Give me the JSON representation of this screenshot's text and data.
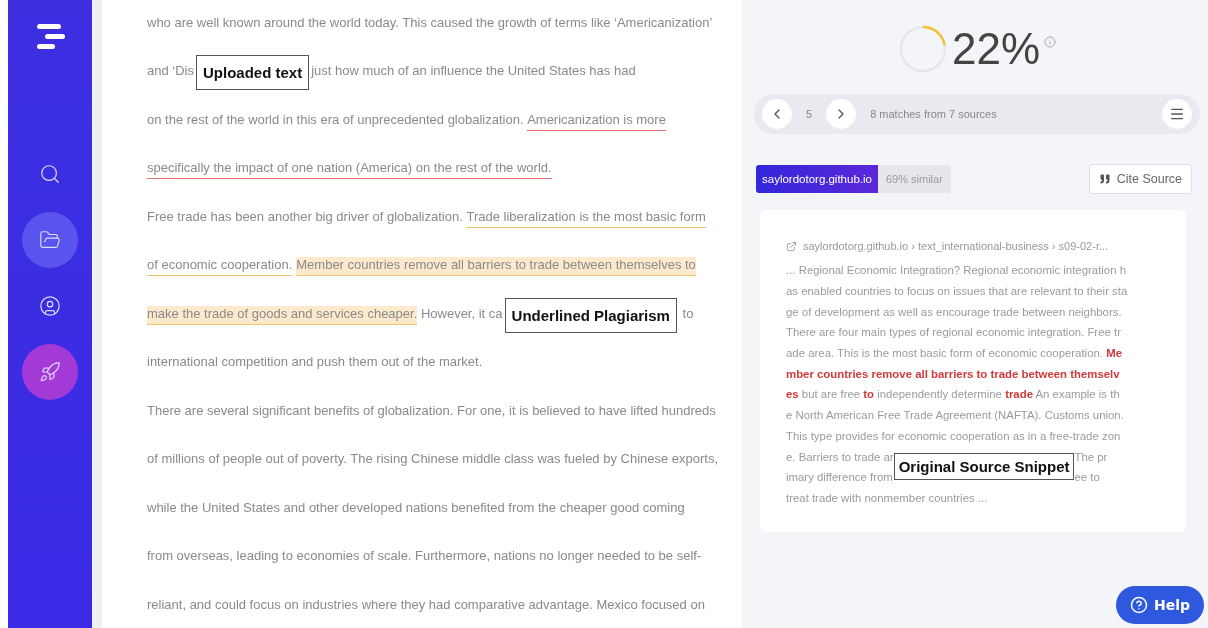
{
  "sidebar": {
    "items": [
      {
        "kind": "nav",
        "selected": false
      },
      {
        "kind": "nav",
        "selected": true
      },
      {
        "kind": "nav",
        "selected": false
      },
      {
        "kind": "accent",
        "selected": false
      }
    ]
  },
  "document": {
    "lines": [
      [
        {
          "text": "who are well known around the world today. This caused the growth of terms like ‘Americanization’",
          "kind": "plain"
        }
      ],
      [
        {
          "text": "and ‘Dis",
          "kind": "plain"
        },
        {
          "kind": "callout",
          "text": "Uploaded text"
        },
        {
          "text": "just how much of an influence the United States has had",
          "kind": "plain"
        }
      ],
      [
        {
          "text": "on the rest of the world in this era of unprecedented globalization. ",
          "kind": "plain"
        },
        {
          "text": "Americanization is more",
          "kind": "match"
        }
      ],
      [
        {
          "text": "specifically the impact of one nation (America) on the rest of the world.",
          "kind": "match"
        }
      ],
      [
        {
          "text": "Free trade has been another big driver of globalization. ",
          "kind": "plain"
        },
        {
          "text": "Trade liberalization is the most basic form",
          "kind": "partial"
        }
      ],
      [
        {
          "text": "of economic cooperation.",
          "kind": "partial"
        },
        {
          "text": "Member countries remove all barriers to trade between themselves to",
          "kind": "highlight"
        }
      ],
      [
        {
          "text": "make the trade of goods and services cheaper.",
          "kind": "highlight"
        },
        {
          "text": " However, it ca",
          "kind": "plain"
        },
        {
          "kind": "callout",
          "text": "Underlined Plagiarism"
        },
        {
          "text": " to",
          "kind": "plain"
        }
      ],
      [
        {
          "text": "international competition and push them out of the market.",
          "kind": "plain"
        }
      ],
      [
        {
          "text": "There are several significant benefits of globalization. For one, it is believed to have lifted hundreds",
          "kind": "plain"
        }
      ],
      [
        {
          "text": "of millions of people out of poverty. The rising Chinese middle class was fueled by Chinese exports,",
          "kind": "plain"
        }
      ],
      [
        {
          "text": "while the United States and other developed nations benefited from the cheaper good coming",
          "kind": "plain"
        }
      ],
      [
        {
          "text": "from overseas, leading to economies of scale. Furthermore, nations no longer needed to be self-",
          "kind": "plain"
        }
      ],
      [
        {
          "text": "reliant, and could focus on industries where they had comparative advantage. Mexico focused on",
          "kind": "plain"
        }
      ]
    ]
  },
  "score": {
    "value": "22%",
    "level": 0.22
  },
  "navigator": {
    "current": "5",
    "summary": "8 matches from 7 sources"
  },
  "source": {
    "name": "saylordotorg.github.io",
    "similarity": "69% similar",
    "cite_button": "Cite Source",
    "breadcrumb": "saylordotorg.github.io › text_international-business › s09-02-r...",
    "lines_before": [
      [
        {
          "text": "... Regional Economic Integration? Regional economic integration h",
          "match": false
        }
      ],
      [
        {
          "text": "as enabled countries to focus on issues that are relevant to their sta",
          "match": false
        }
      ],
      [
        {
          "text": "ge of development as well as encourage trade between neighbors.",
          "match": false
        }
      ],
      [
        {
          "text": "There are four main types of regional economic integration. Free tr",
          "match": false
        }
      ],
      [
        {
          "text": "ade area. This is the most basic form of economic cooperation. ",
          "match": false
        },
        {
          "text": "Me",
          "match": true
        }
      ],
      [
        {
          "text": "mber countries remove all barriers to trade between themselv",
          "match": true
        }
      ],
      [
        {
          "text": "es",
          "match": true
        },
        {
          "text": " but are free ",
          "match": false
        },
        {
          "text": "to",
          "match": true
        },
        {
          "text": " independently determine ",
          "match": false
        },
        {
          "text": "trade",
          "match": true
        },
        {
          "text": " An example is th",
          "match": false
        }
      ],
      [
        {
          "text": "e North American Free Trade Agreement (NAFTA). Customs union.",
          "match": false
        }
      ],
      [
        {
          "text": "This type provides for economic cooperation as in a free-trade zon",
          "match": false
        }
      ]
    ],
    "covered_rows": [
      {
        "left": "e. Barriers to trade ar",
        "right": "The pr"
      },
      {
        "left": "imary difference from",
        "right": "ee to"
      }
    ],
    "callout": "Original Source Snippet",
    "lines_after": [
      [
        {
          "text": "treat trade with nonmember countries ...",
          "match": false
        }
      ]
    ]
  },
  "help_button": "Help"
}
